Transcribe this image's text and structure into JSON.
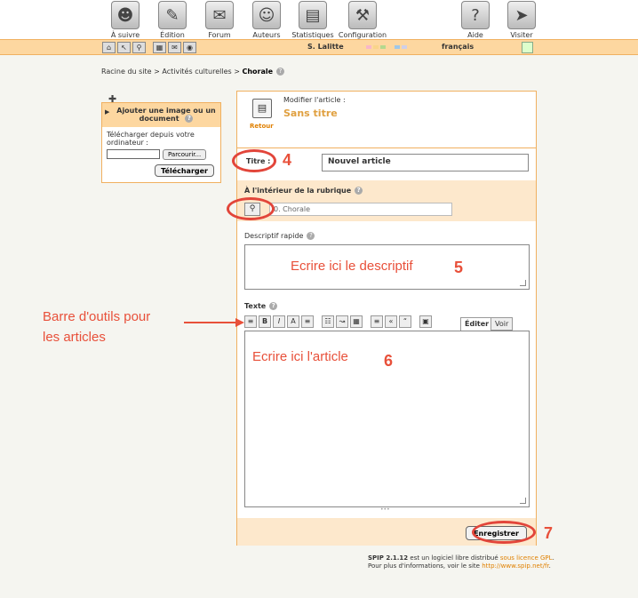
{
  "nav": {
    "items": [
      {
        "label": "À suivre",
        "icon": "person-icon"
      },
      {
        "label": "Édition",
        "icon": "pen-icon"
      },
      {
        "label": "Forum",
        "icon": "speech-bubble-icon"
      },
      {
        "label": "Auteurs",
        "icon": "people-icon"
      },
      {
        "label": "Statistiques",
        "icon": "printer-chart-icon"
      },
      {
        "label": "Configuration",
        "icon": "tools-icon"
      },
      {
        "label": "Aide",
        "icon": "question-icon"
      },
      {
        "label": "Visiter",
        "icon": "arrow-right-icon"
      }
    ]
  },
  "topbar": {
    "user": "S. Lalitte",
    "language": "français",
    "swatch_colors": [
      "#f7b6c8",
      "#f9d48a",
      "#b4d88e",
      "#9fc7e8",
      "#cfcfe8"
    ]
  },
  "breadcrumb": {
    "path": "Racine du site > Activités culturelles > ",
    "current": "Chorale"
  },
  "leftbox": {
    "title": "Ajouter une image ou un document",
    "upload_text": "Télécharger depuis votre ordinateur :",
    "browse_label": "Parcourir...",
    "upload_label": "Télécharger"
  },
  "header": {
    "modify_label": "Modifier l'article :",
    "article_title": "Sans titre",
    "back_label": "Retour"
  },
  "form": {
    "title_label": "Titre :",
    "title_value": "Nouvel article",
    "rubrique_label": "À l'intérieur de la rubrique",
    "rubrique_value": "0. Chorale",
    "desc_label": "Descriptif rapide",
    "texte_label": "Texte",
    "tab_edit": "Éditer",
    "tab_view": "Voir",
    "save_label": "Enregistrer"
  },
  "credits": {
    "line1_prefix": "SPIP 2.1.12",
    "line1_mid": " est un logiciel libre distribué ",
    "line1_link": "sous licence GPL",
    "line1_end": ".",
    "line2_prefix": "Pour plus d'informations, voir le site ",
    "line2_link": "http://www.spip.net/fr",
    "line2_end": "."
  },
  "annotations": {
    "n4": "4",
    "n5": "5",
    "n6": "6",
    "n7": "7",
    "desc_hint": "Ecrire ici le descriptif",
    "article_hint": "Ecrire ici l'article",
    "toolbar_hint_1": "Barre d'outils pour",
    "toolbar_hint_2": "les articles",
    "accent_color": "#e8503a"
  }
}
